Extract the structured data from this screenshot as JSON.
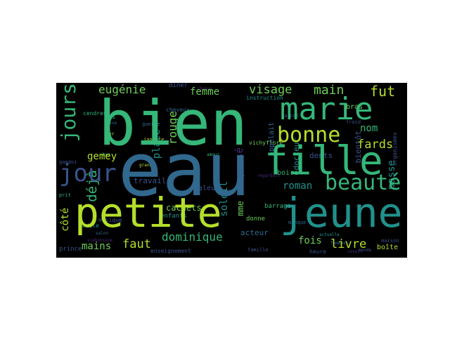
{
  "palette": {
    "background": "#000000",
    "page": "#ffffff",
    "c_dark": "#3b528b",
    "c_blue": "#31688e",
    "c_teal": "#21918c",
    "c_green": "#35b779",
    "c_lime": "#6ece58",
    "c_yellow": "#b5de2b",
    "c_purple": "#472d7b"
  },
  "words": {
    "bien": "bien",
    "eau": "eau",
    "marie": "marie",
    "fille": "fille",
    "petite": "petite",
    "jeune": "jeune",
    "jours": "jours",
    "jour": "jour",
    "bonne": "bonne",
    "beaute": "beauté",
    "visage": "visage",
    "main": "main",
    "fut": "fut",
    "femme": "femme",
    "eugenie": "eugénie",
    "deja": "déjà",
    "gemey": "gemey",
    "rouge": "rouge",
    "place": "place",
    "fards": "fards",
    "nom": "nom",
    "bras": "bras",
    "cote": "côté",
    "mains": "mains",
    "faut": "faut",
    "dominique": "dominique",
    "livre": "livre",
    "fois": "fois",
    "roman": "roman",
    "passe": "passé",
    "passe2": "passe",
    "soleil": "soleil",
    "cachets": "cachets",
    "docteur": "docteur",
    "boire": "boire",
    "dents": "dents",
    "bientot": "bientôt",
    "appelait": "appelait",
    "valeur": "valeur",
    "travail": "travail",
    "enfants": "enfants",
    "acteur": "acteur",
    "donne": "donne",
    "boite": "boîte",
    "maison": "maison",
    "musique": "musique",
    "modele": "modèle",
    "prince": "prince",
    "fer": "fer",
    "ans": "ans",
    "peine": "peine",
    "cendres": "cendres",
    "cheveux": "cheveux",
    "diner": "dîner",
    "amour": "amour",
    "barrage": "barrage",
    "vichyflore": "vichyflore",
    "instruction": "instruction",
    "janette": "janette",
    "salon": "salon",
    "enseignement": "enseignement",
    "famille": "famille",
    "heure": "heure",
    "femmes": "femmes",
    "monde": "monde",
    "actuelle": "actuelle",
    "manque": "manque",
    "froid": "froid",
    "marcel": "marcel",
    "organismes": "organismes",
    "guerre": "guerre",
    "bon": "bon",
    "gandoi": "gandoi",
    "prit": "prit",
    "siphonsine": "siphonsine",
    "cesait": "cesait",
    "chaque": "chaque",
    "grande": "grande",
    "regardait": "regardait",
    "ecole": "école",
    "vendredi": "vendredi",
    "mot": "mot",
    "nuit": "nuit",
    "comme": "comme",
    "cause": "cause",
    "sait": "sait",
    "seule": "seule",
    "soir": "soir",
    "bout": "bout",
    "mme": "mme",
    "mere": "mère",
    "vie": "vie",
    "coeur": "cœur",
    "pere": "père",
    "temps": "temps",
    "tete": "tête",
    "yeux": "yeux",
    "homme": "homme",
    "chose": "chose",
    "porte": "porte",
    "robe": "robe",
    "rien": "rien",
    "ville": "ville",
    "moment": "moment",
    "corps": "corps",
    "gens": "gens",
    "pris": "pris",
    "fond": "fond",
    "dieu": "dieu",
    "alors": "alors",
    "vers": "vers",
    "dit": "dit",
    "voir": "voir",
    "fin": "fin",
    "air": "air",
    "rue": "rue",
    "lit": "lit",
    "mari": "mari",
    "jamais": "jamais",
    "aussi": "aussi",
    "toujours": "toujours",
    "encore": "encore",
    "pourtant": "pourtant",
    "enfin": "enfin"
  }
}
